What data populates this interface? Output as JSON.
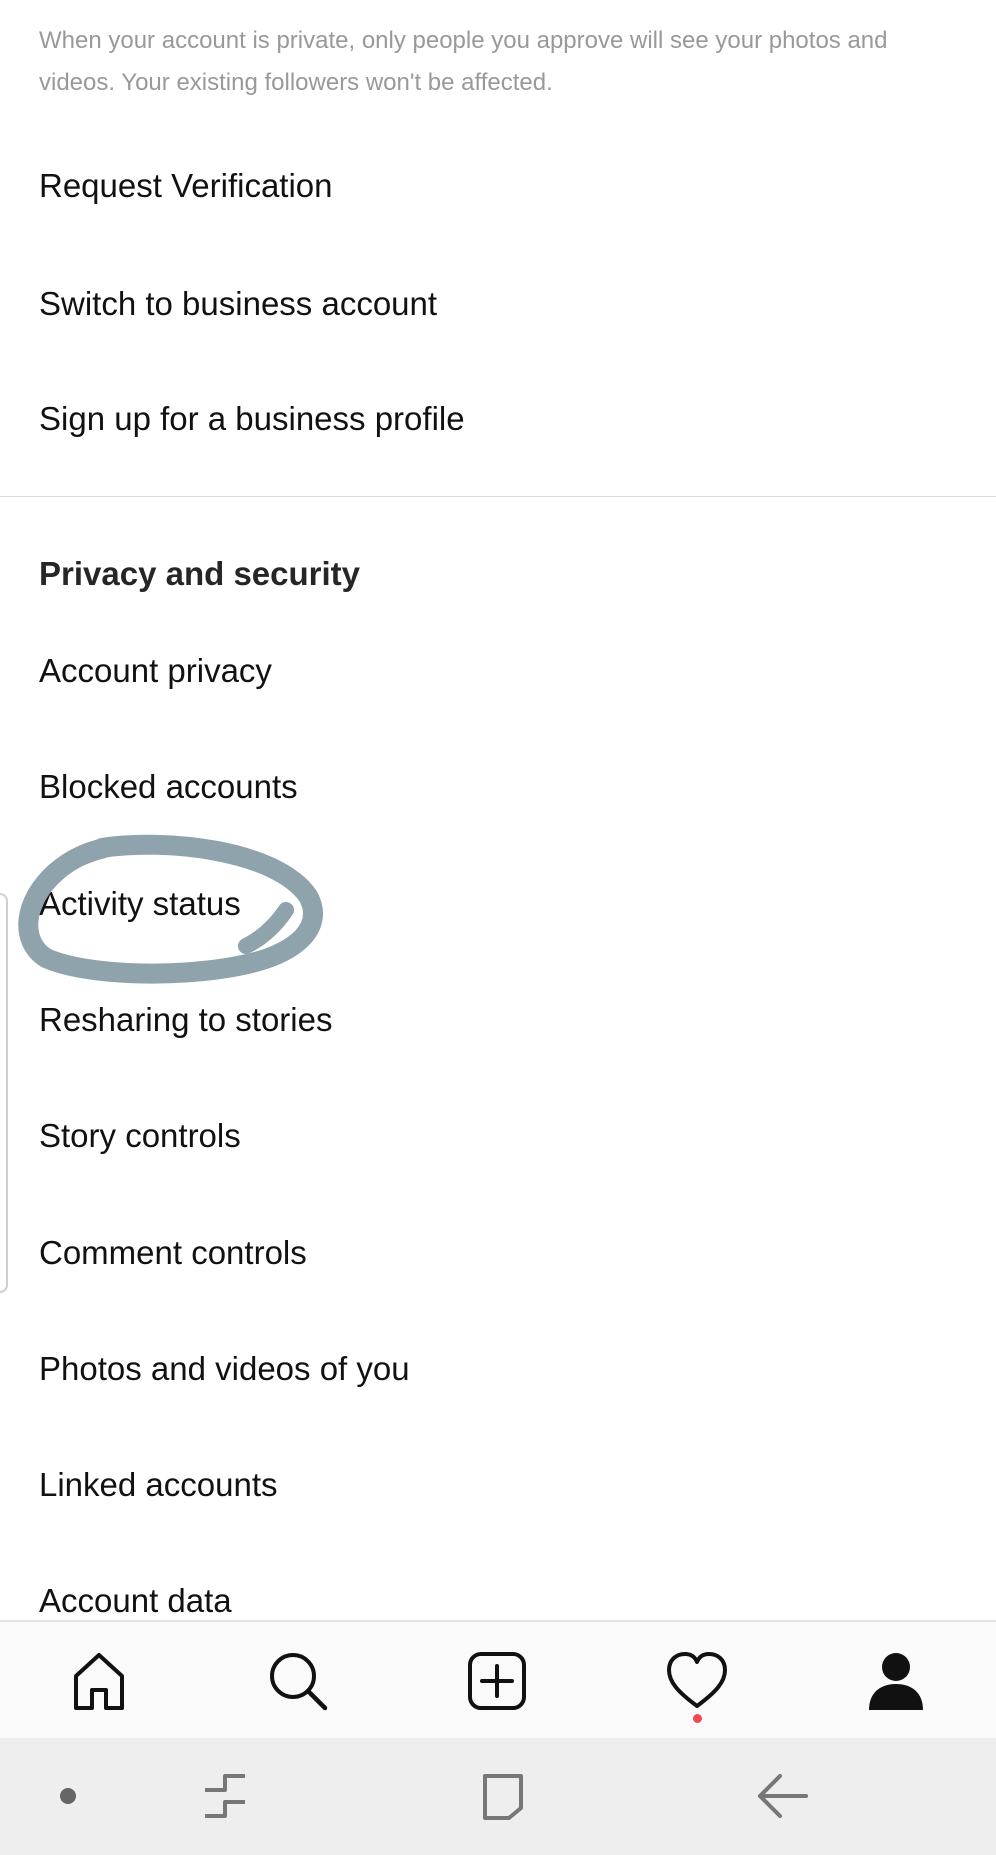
{
  "settings": {
    "privacy_note": "When your account is private, only people you approve will see your photos and videos. Your existing followers won't be affected.",
    "account_items": [
      {
        "label": "Request Verification"
      },
      {
        "label": "Switch to business account"
      },
      {
        "label": "Sign up for a business profile"
      }
    ],
    "privacy_section": {
      "title": "Privacy and security",
      "items": [
        {
          "label": "Account privacy"
        },
        {
          "label": "Blocked accounts"
        },
        {
          "label": "Activity status"
        },
        {
          "label": "Resharing to stories"
        },
        {
          "label": "Story controls"
        },
        {
          "label": "Comment controls"
        },
        {
          "label": "Photos and videos of you"
        },
        {
          "label": "Linked accounts"
        },
        {
          "label": "Account data"
        }
      ]
    }
  },
  "annotation": {
    "color": "#8fa3ad",
    "marks": "Activity status"
  },
  "tab_bar": {
    "tabs": [
      "home-icon",
      "search-icon",
      "new-post-icon",
      "activity-heart-icon",
      "profile-icon"
    ],
    "active": "profile-icon",
    "notification_dot_color": "#ed4956"
  },
  "system_nav": {
    "buttons": [
      "dot-icon",
      "recent-apps-icon",
      "home-square-icon",
      "back-arrow-icon"
    ]
  }
}
